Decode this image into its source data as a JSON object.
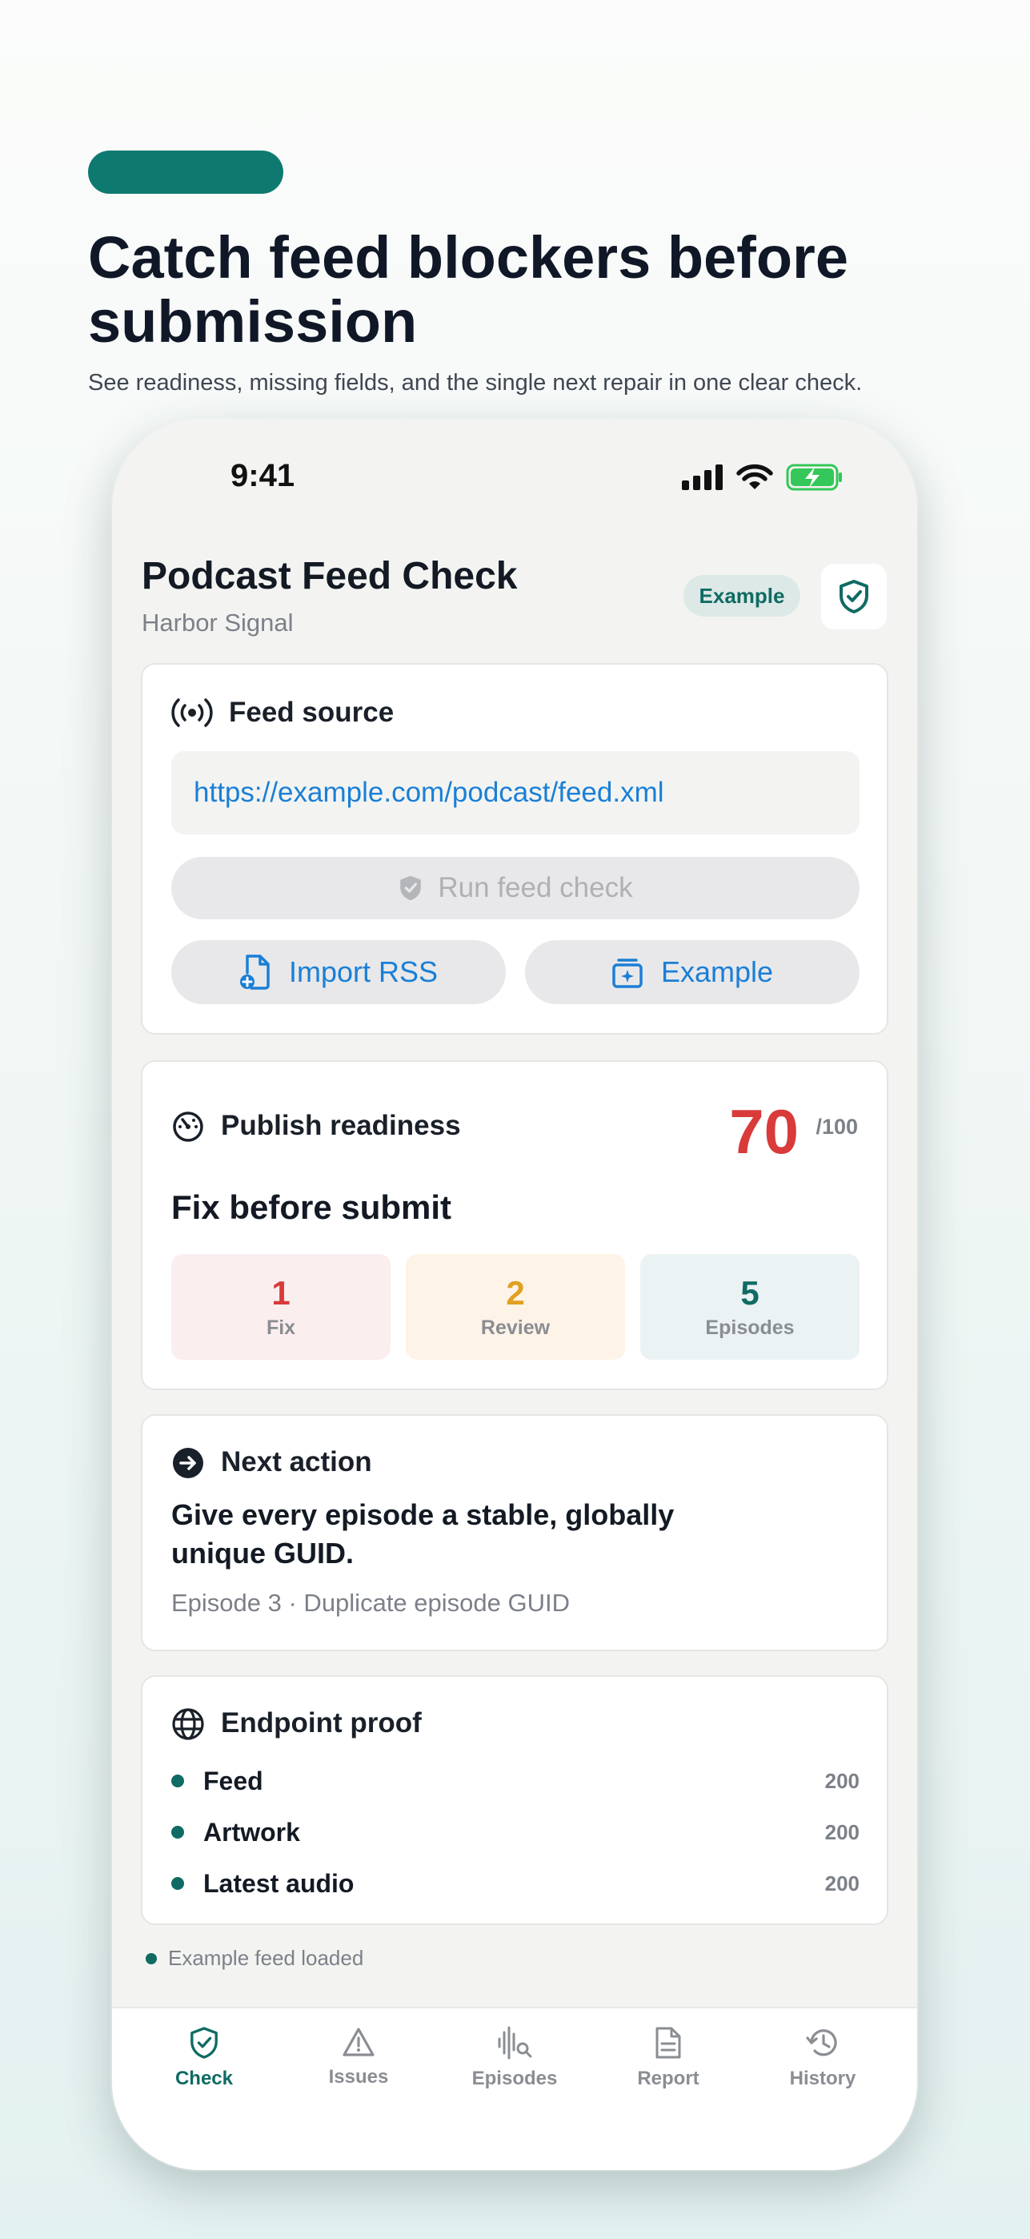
{
  "hero": {
    "title": "Catch feed blockers before submission",
    "subtitle": "See readiness, missing fields, and the single next repair in one clear check."
  },
  "status_bar": {
    "time": "9:41"
  },
  "header": {
    "title": "Podcast Feed Check",
    "subtitle": "Harbor Signal",
    "badge": "Example"
  },
  "feed_source": {
    "title": "Feed source",
    "url": "https://example.com/podcast/feed.xml",
    "run_label": "Run feed check",
    "import_label": "Import RSS",
    "example_label": "Example"
  },
  "readiness": {
    "title": "Publish readiness",
    "score": "70",
    "score_max": "/100",
    "verdict": "Fix before submit",
    "stats": [
      {
        "value": "1",
        "label": "Fix"
      },
      {
        "value": "2",
        "label": "Review"
      },
      {
        "value": "5",
        "label": "Episodes"
      }
    ]
  },
  "next_action": {
    "title": "Next action",
    "text": "Give every episode a stable, globally unique GUID.",
    "meta": "Episode 3 · Duplicate episode GUID"
  },
  "endpoint_proof": {
    "title": "Endpoint proof",
    "rows": [
      {
        "name": "Feed",
        "code": "200"
      },
      {
        "name": "Artwork",
        "code": "200"
      },
      {
        "name": "Latest audio",
        "code": "200"
      }
    ]
  },
  "toast": "Example feed loaded",
  "tabs": [
    {
      "label": "Check",
      "icon": "shield-check-icon",
      "active": true
    },
    {
      "label": "Issues",
      "icon": "warning-icon"
    },
    {
      "label": "Episodes",
      "icon": "waveform-search-icon"
    },
    {
      "label": "Report",
      "icon": "document-icon"
    },
    {
      "label": "History",
      "icon": "history-icon"
    }
  ],
  "colors": {
    "accent": "#0f6b63",
    "link": "#1a7fd6",
    "danger": "#d93a3a",
    "warning": "#e0a020",
    "battery": "#34c759"
  }
}
